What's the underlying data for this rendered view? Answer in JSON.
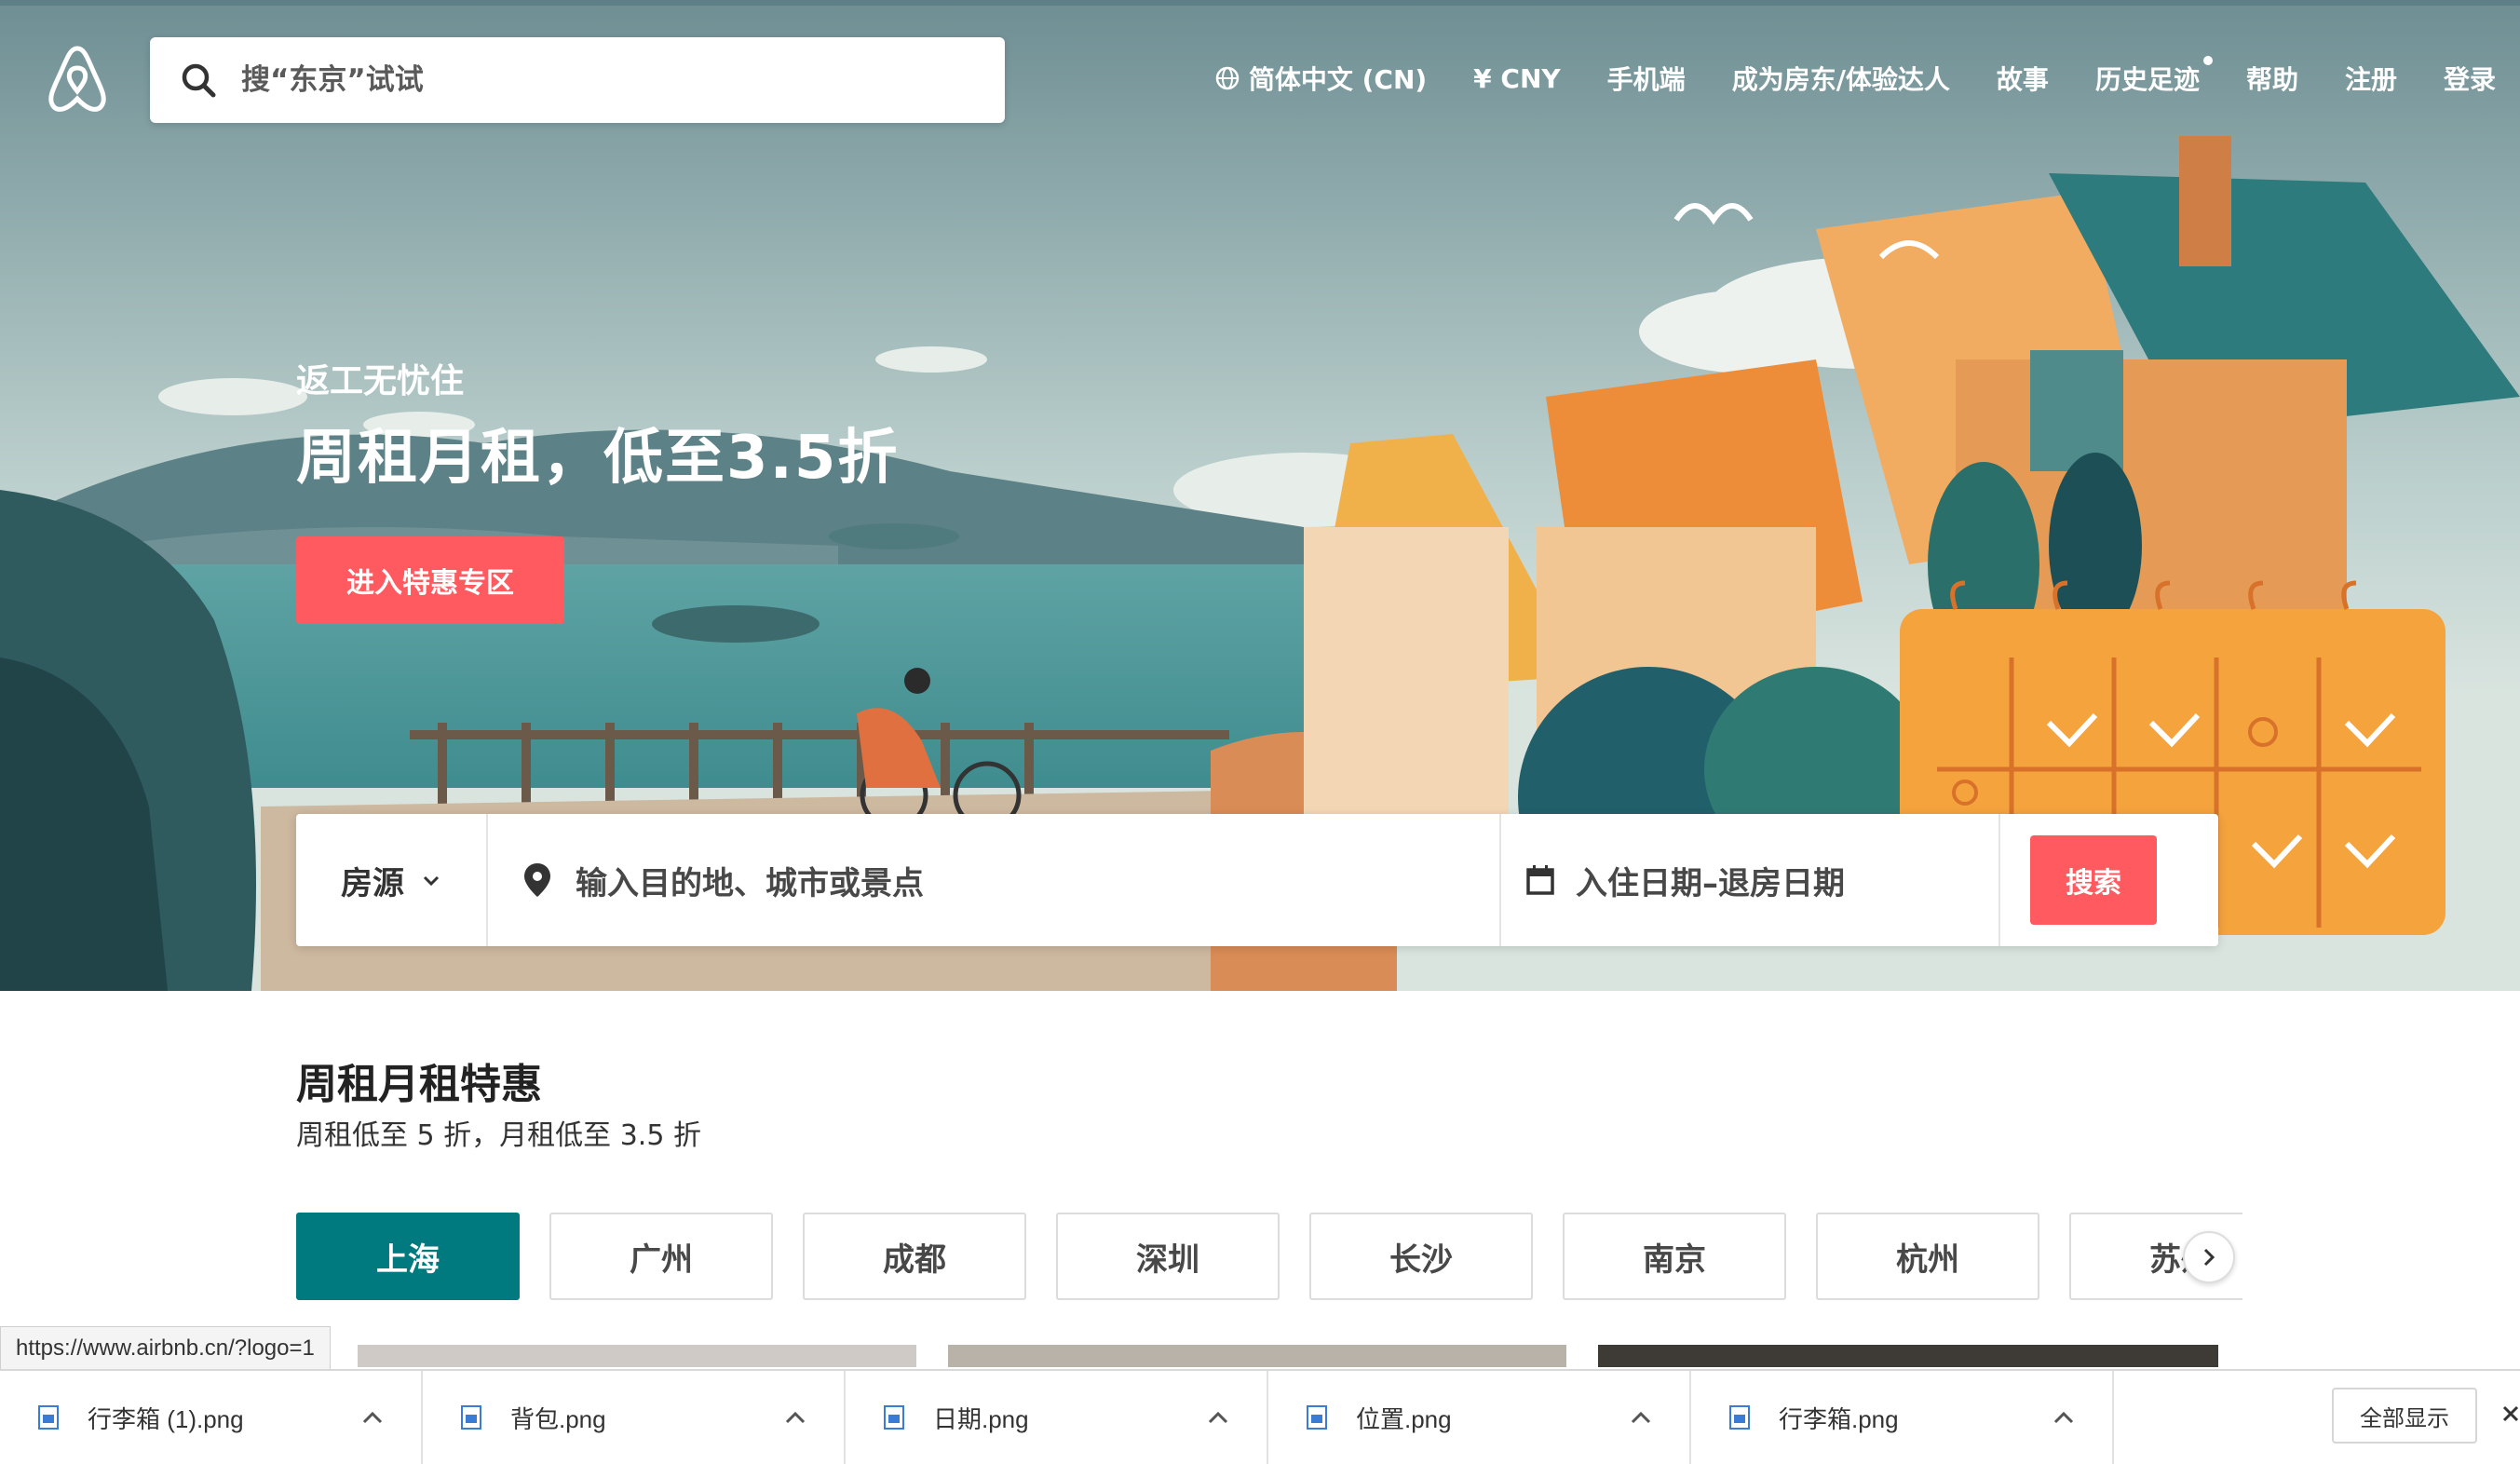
{
  "header": {
    "search_placeholder": "搜“东京”试试",
    "nav": [
      "简体中文 (CN)",
      "¥ CNY",
      "手机端",
      "成为房东/体验达人",
      "故事",
      "历史足迹",
      "帮助",
      "注册",
      "登录"
    ]
  },
  "hero": {
    "subtitle": "返工无忧住",
    "title": "周租月租，低至3.5折",
    "cta": "进入特惠专区"
  },
  "search": {
    "type_label": "房源",
    "destination_placeholder": "输入目的地、城市或景点",
    "dates_placeholder": "入住日期–退房日期",
    "button": "搜索"
  },
  "section": {
    "title": "周租月租特惠",
    "subtitle": "周租低至 5 折，月租低至 3.5 折",
    "cities": [
      "上海",
      "广州",
      "成都",
      "深圳",
      "长沙",
      "南京",
      "杭州",
      "苏州"
    ]
  },
  "status_url": "https://www.airbnb.cn/?logo=1",
  "downloads": {
    "items": [
      "行李箱 (1).png",
      "背包.png",
      "日期.png",
      "位置.png",
      "行李箱.png"
    ],
    "show_all": "全部显示"
  },
  "colors": {
    "brand": "#ff5a5f",
    "active_tab": "#007a7e"
  }
}
